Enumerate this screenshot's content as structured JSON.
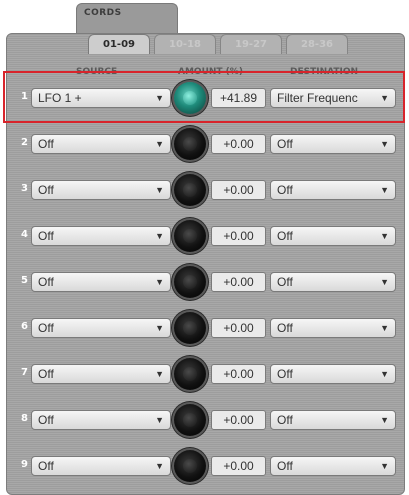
{
  "header": {
    "section_label": "CORDS"
  },
  "pages": [
    {
      "label": "01-09",
      "active": true
    },
    {
      "label": "10-18",
      "active": false
    },
    {
      "label": "19-27",
      "active": false
    },
    {
      "label": "28-36",
      "active": false
    }
  ],
  "columns": {
    "source": "SOURCE",
    "amount": "AMOUNT (%)",
    "destination": "DESTINATION"
  },
  "rows": [
    {
      "num": "1",
      "source": "LFO 1 +",
      "amount": "+41.89",
      "destination": "Filter Frequenc",
      "knob": "green-knob"
    },
    {
      "num": "2",
      "source": "Off",
      "amount": "+0.00",
      "destination": "Off",
      "knob": "black-knob"
    },
    {
      "num": "3",
      "source": "Off",
      "amount": "+0.00",
      "destination": "Off",
      "knob": "black-knob"
    },
    {
      "num": "4",
      "source": "Off",
      "amount": "+0.00",
      "destination": "Off",
      "knob": "black-knob"
    },
    {
      "num": "5",
      "source": "Off",
      "amount": "+0.00",
      "destination": "Off",
      "knob": "black-knob"
    },
    {
      "num": "6",
      "source": "Off",
      "amount": "+0.00",
      "destination": "Off",
      "knob": "black-knob"
    },
    {
      "num": "7",
      "source": "Off",
      "amount": "+0.00",
      "destination": "Off",
      "knob": "black-knob"
    },
    {
      "num": "8",
      "source": "Off",
      "amount": "+0.00",
      "destination": "Off",
      "knob": "black-knob"
    },
    {
      "num": "9",
      "source": "Off",
      "amount": "+0.00",
      "destination": "Off",
      "knob": "black-knob"
    }
  ],
  "colors": {
    "highlight": "#d8242b",
    "panel": "#a3a3a3",
    "knob_active": "#1e8a7a"
  },
  "icons": {
    "dropdown": "chevron-down-icon"
  }
}
